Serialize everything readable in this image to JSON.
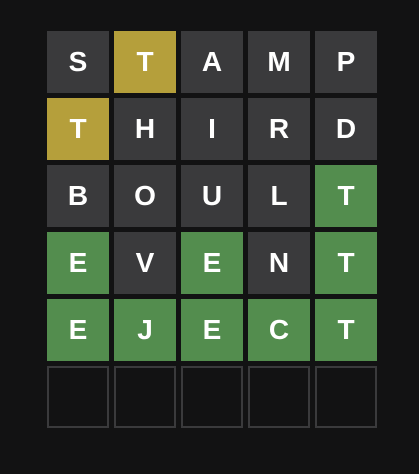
{
  "colors": {
    "background": "#121213",
    "absent": "#3a3a3c",
    "present": "#b59f3b",
    "correct": "#538d4e",
    "empty_border": "#3a3a3c",
    "letter": "#ffffff"
  },
  "board": {
    "rows": [
      {
        "tiles": [
          {
            "letter": "S",
            "state": "absent"
          },
          {
            "letter": "T",
            "state": "present"
          },
          {
            "letter": "A",
            "state": "absent"
          },
          {
            "letter": "M",
            "state": "absent"
          },
          {
            "letter": "P",
            "state": "absent"
          }
        ]
      },
      {
        "tiles": [
          {
            "letter": "T",
            "state": "present"
          },
          {
            "letter": "H",
            "state": "absent"
          },
          {
            "letter": "I",
            "state": "absent"
          },
          {
            "letter": "R",
            "state": "absent"
          },
          {
            "letter": "D",
            "state": "absent"
          }
        ]
      },
      {
        "tiles": [
          {
            "letter": "B",
            "state": "absent"
          },
          {
            "letter": "O",
            "state": "absent"
          },
          {
            "letter": "U",
            "state": "absent"
          },
          {
            "letter": "L",
            "state": "absent"
          },
          {
            "letter": "T",
            "state": "correct"
          }
        ]
      },
      {
        "tiles": [
          {
            "letter": "E",
            "state": "correct"
          },
          {
            "letter": "V",
            "state": "absent"
          },
          {
            "letter": "E",
            "state": "correct"
          },
          {
            "letter": "N",
            "state": "absent"
          },
          {
            "letter": "T",
            "state": "correct"
          }
        ]
      },
      {
        "tiles": [
          {
            "letter": "E",
            "state": "correct"
          },
          {
            "letter": "J",
            "state": "correct"
          },
          {
            "letter": "E",
            "state": "correct"
          },
          {
            "letter": "C",
            "state": "correct"
          },
          {
            "letter": "T",
            "state": "correct"
          }
        ]
      },
      {
        "tiles": [
          {
            "letter": "",
            "state": "empty"
          },
          {
            "letter": "",
            "state": "empty"
          },
          {
            "letter": "",
            "state": "empty"
          },
          {
            "letter": "",
            "state": "empty"
          },
          {
            "letter": "",
            "state": "empty"
          }
        ]
      }
    ]
  }
}
